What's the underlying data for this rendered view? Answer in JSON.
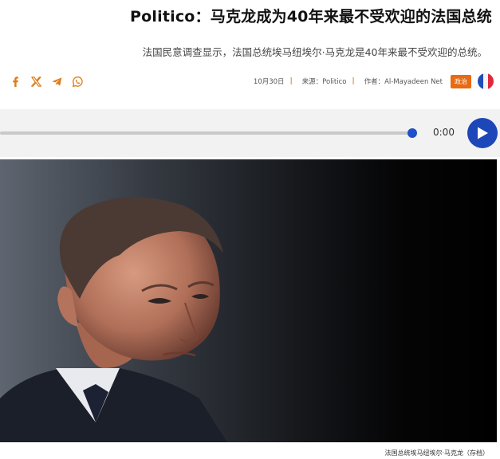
{
  "article": {
    "headline": "Politico：马克龙成为40年来最不受欢迎的法国总统",
    "subtitle": "法国民意调查显示，法国总统埃马纽埃尔·马克龙是40年来最不受欢迎的总统。"
  },
  "share": {
    "icons": [
      "facebook-icon",
      "x-icon",
      "telegram-icon",
      "whatsapp-icon"
    ]
  },
  "meta": {
    "date": "10月30日",
    "source": "来源：Politico",
    "author": "作者：Al-Mayadeen Net",
    "tag": "政治",
    "flag": "france-flag-icon"
  },
  "audio": {
    "time": "0:00",
    "progress": 1.0
  },
  "photo": {
    "caption": "法国总统埃马纽埃尔·马克龙（存档）"
  },
  "colors": {
    "accent": "#1d46b8",
    "tag": "#e86a12",
    "separator": "#e07b18",
    "social": "#e07b18"
  }
}
